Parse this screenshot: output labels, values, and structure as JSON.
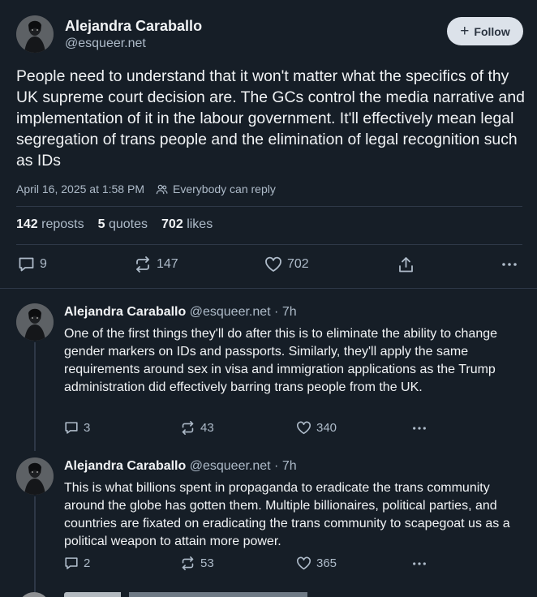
{
  "main": {
    "author": {
      "name": "Alejandra Caraballo",
      "handle": "@esqueer.net"
    },
    "follow_label": "Follow",
    "text": "People need to understand that it won't matter what the specifics of thy UK supreme court decision are. The GCs control the media narrative and implementation of it in the labour government. It'll effectively mean legal segregation of trans people and the elimination of legal recognition such as IDs",
    "timestamp": "April 16, 2025 at 1:58 PM",
    "reply_setting": "Everybody can reply",
    "stats": {
      "reposts_count": "142",
      "reposts_label": "reposts",
      "quotes_count": "5",
      "quotes_label": "quotes",
      "likes_count": "702",
      "likes_label": "likes"
    },
    "actions": {
      "replies": "9",
      "reposts": "147",
      "likes": "702"
    }
  },
  "replies": [
    {
      "name": "Alejandra Caraballo",
      "handle_time": "@esqueer.net · 7h",
      "text": "One of the first things they'll do after this is to eliminate the ability to change gender markers on IDs and passports. Similarly, they'll apply the same requirements around sex in visa and immigration applications as the Trump administration did effectively barring trans people from the UK.",
      "replies": "3",
      "reposts": "43",
      "likes": "340"
    },
    {
      "name": "Alejandra Caraballo",
      "handle_time": "@esqueer.net · 7h",
      "text": "This is what billions spent in propaganda to eradicate the trans community around the globe has gotten them. Multiple billionaires, political parties, and countries are fixated on eradicating the trans community to scapegoat us as a political weapon to attain more power.",
      "replies": "2",
      "reposts": "53",
      "likes": "365"
    }
  ],
  "icons": {
    "reply": "speech-bubble-icon",
    "repost": "repost-arrows-icon",
    "like": "heart-icon",
    "share": "share-upload-icon",
    "more": "ellipsis-icon",
    "audience": "people-icon",
    "follow": "plus-icon"
  },
  "colors": {
    "background": "#161e27",
    "text": "#f1f3f5",
    "muted": "#aebbc9",
    "divider": "#2e3847",
    "follow_bg": "#dce2ea"
  }
}
